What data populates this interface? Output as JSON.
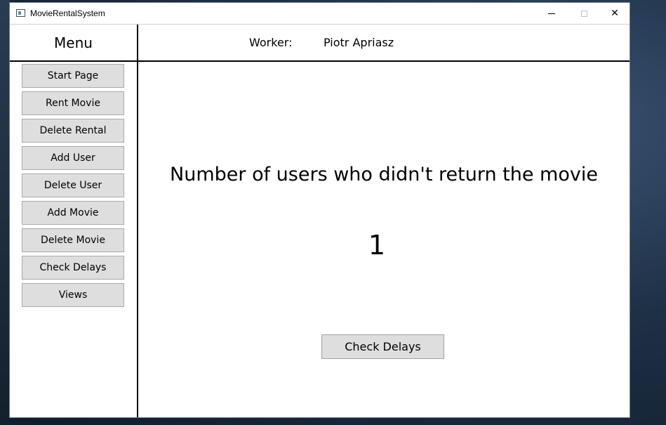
{
  "window": {
    "title": "MovieRentalSystem",
    "minimize_icon": "minimize-icon",
    "maximize_icon": "maximize-icon",
    "close_icon": "close-icon",
    "close_glyph": "✕"
  },
  "menu": {
    "header": "Menu",
    "items": [
      {
        "label": "Start Page"
      },
      {
        "label": "Rent Movie"
      },
      {
        "label": "Delete Rental"
      },
      {
        "label": "Add User"
      },
      {
        "label": "Delete User"
      },
      {
        "label": "Add Movie"
      },
      {
        "label": "Delete Movie"
      },
      {
        "label": "Check Delays"
      },
      {
        "label": "Views"
      }
    ]
  },
  "header": {
    "worker_label": "Worker:",
    "worker_name": "Piotr Apriasz"
  },
  "main": {
    "title": "Number of users who didn't return the movie",
    "count": "1",
    "action_label": "Check Delays"
  },
  "colors": {
    "button_bg": "#dedede",
    "border": "#000000"
  }
}
